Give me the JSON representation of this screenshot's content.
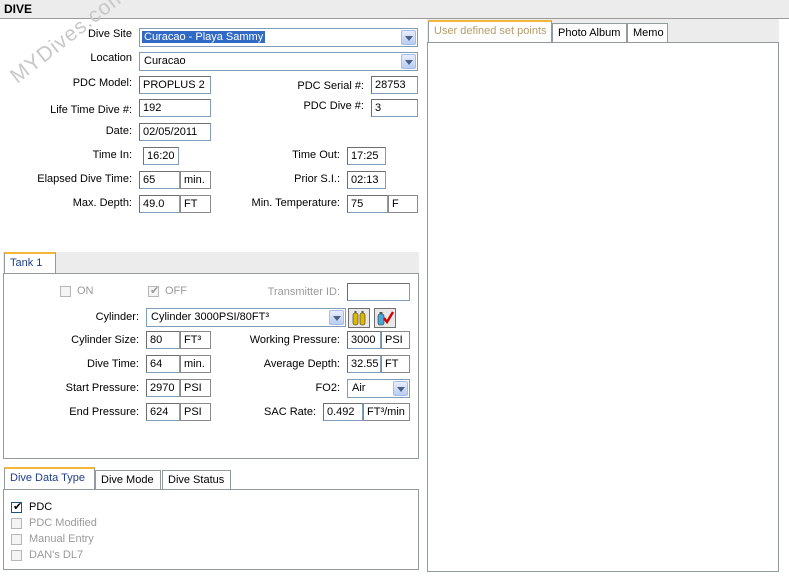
{
  "header": {
    "title": "DIVE"
  },
  "watermark": "MYDives.com",
  "dive": {
    "dive_site": {
      "label": "Dive Site",
      "value": "Curacao - Playa Sammy"
    },
    "location": {
      "label": "Location",
      "value": "Curacao"
    },
    "pdc_model": {
      "label": "PDC Model:",
      "value": "PROPLUS 2"
    },
    "pdc_serial": {
      "label": "PDC Serial #:",
      "value": "28753"
    },
    "lifetime_dive": {
      "label": "Life Time Dive #:",
      "value": "192"
    },
    "pdc_dive": {
      "label": "PDC Dive #:",
      "value": "3"
    },
    "date": {
      "label": "Date:",
      "value": "02/05/2011"
    },
    "time_in": {
      "label": "Time In:",
      "value": "16:20"
    },
    "time_out": {
      "label": "Time Out:",
      "value": "17:25"
    },
    "elapsed": {
      "label": "Elapsed Dive Time:",
      "value": "65",
      "unit": "min."
    },
    "prior_si": {
      "label": "Prior S.I.:",
      "value": "02:13"
    },
    "max_depth": {
      "label": "Max. Depth:",
      "value": "49.0",
      "unit": "FT"
    },
    "min_temp": {
      "label": "Min. Temperature:",
      "value": "75",
      "unit": "F"
    }
  },
  "tank": {
    "tab_label": "Tank 1",
    "on_label": "ON",
    "off_label": "OFF",
    "transmitter": {
      "label": "Transmitter ID:",
      "value": ""
    },
    "cylinder": {
      "label": "Cylinder:",
      "value": "Cylinder 3000PSI/80FT³"
    },
    "cylinder_size": {
      "label": "Cylinder Size:",
      "value": "80",
      "unit": "FT³"
    },
    "working_pressure": {
      "label": "Working Pressure:",
      "value": "3000",
      "unit": "PSI"
    },
    "dive_time": {
      "label": "Dive Time:",
      "value": "64",
      "unit": "min."
    },
    "avg_depth": {
      "label": "Average Depth:",
      "value": "32.55",
      "unit": "FT"
    },
    "start_pressure": {
      "label": "Start Pressure:",
      "value": "2970",
      "unit": "PSI"
    },
    "fo2": {
      "label": "FO2:",
      "value": "Air"
    },
    "end_pressure": {
      "label": "End Pressure:",
      "value": "624",
      "unit": "PSI"
    },
    "sac_rate": {
      "label": "SAC Rate:",
      "value": "0.492",
      "unit": "FT³/min"
    }
  },
  "data_tabs": {
    "tabs": [
      "Dive Data Type",
      "Dive Mode",
      "Dive Status"
    ],
    "options": [
      {
        "label": "PDC",
        "checked": true,
        "enabled": true
      },
      {
        "label": "PDC Modified",
        "checked": false,
        "enabled": false
      },
      {
        "label": "Manual Entry",
        "checked": false,
        "enabled": false
      },
      {
        "label": "DAN's DL7",
        "checked": false,
        "enabled": false
      }
    ]
  },
  "right_tabs": [
    "User defined set points",
    "Photo Album",
    "Memo"
  ],
  "colors": {
    "selection": "#316ac5",
    "tab_accent": "#f3b53a",
    "header_bg": "#ececec"
  }
}
